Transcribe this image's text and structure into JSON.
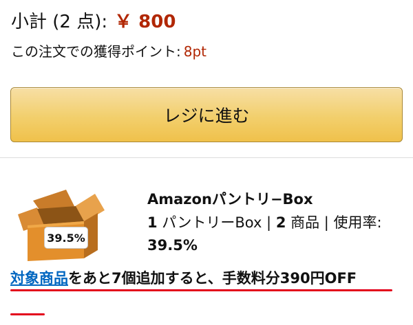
{
  "subtotal": {
    "label": "小計 (2 点):",
    "price": "￥ 800"
  },
  "points": {
    "label": "この注文での獲得ポイント:",
    "value": "8pt"
  },
  "checkout": {
    "label": "レジに進む"
  },
  "pantry": {
    "badge": "39.5%",
    "title": "Amazonパントリ−Box",
    "count_box": "1",
    "box_unit": " パントリーBox | ",
    "count_items": "2",
    "items_unit": " 商品 | 使用率: ",
    "usage": "39.5%"
  },
  "promo": {
    "link": "対象商品",
    "text": "をあと7個追加すると、手数料分390円OFF"
  },
  "colors": {
    "price": "#B12704",
    "link": "#0066c0",
    "button": "#f0c14b",
    "annotation": "#e3001b"
  },
  "icons": {
    "pantry_box": "cardboard-box-icon"
  }
}
